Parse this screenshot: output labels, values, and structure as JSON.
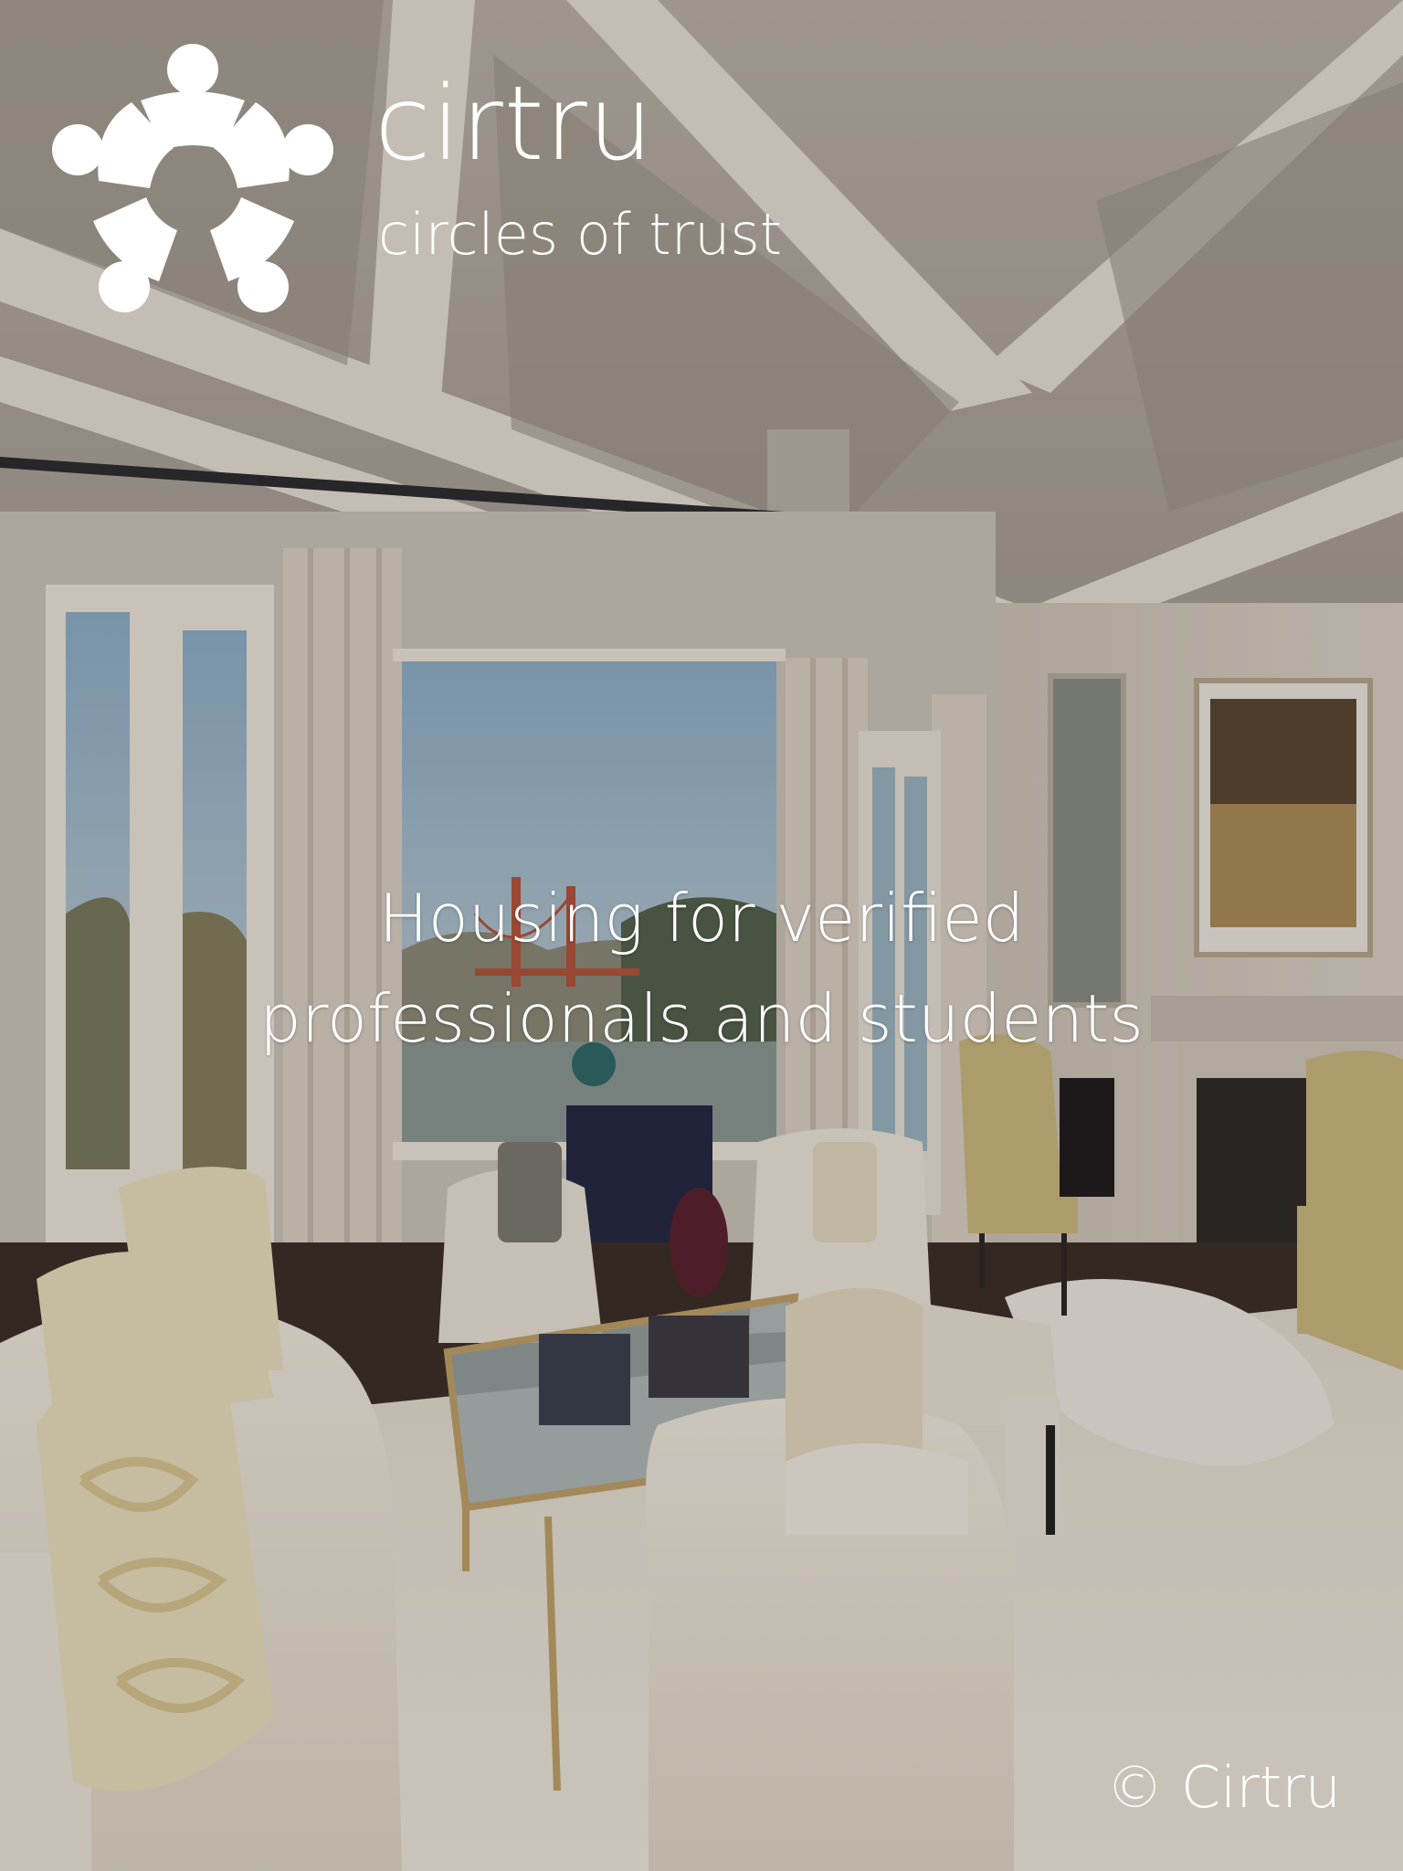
{
  "brand": {
    "name": "cirtru",
    "tagline": "circles of trust",
    "logo_icon": "five-people-circle-icon"
  },
  "hero": {
    "headline_line1": "Housing for verified",
    "headline_line2": "professionals and students",
    "background": "living-room-photo"
  },
  "footer": {
    "copyright": "© Cirtru"
  },
  "colors": {
    "text": "#ffffff",
    "ceiling": "#cfc6bc",
    "wall": "#d8d0c6",
    "floor": "#ece6dc",
    "sky": "#a9c3d6",
    "dark_floor": "#2c241e"
  }
}
